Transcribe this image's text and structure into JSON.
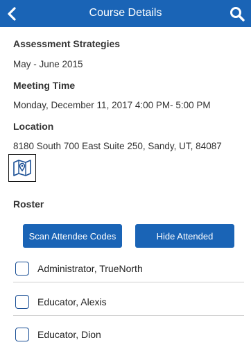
{
  "header": {
    "title": "Course Details",
    "back_icon": "chevron-left-icon",
    "search_icon": "search-icon",
    "color": "#1a64b6"
  },
  "course": {
    "name": "Assessment Strategies",
    "dates": "May - June 2015",
    "meeting_label": "Meeting Time",
    "meeting_value": "Monday, December 11, 2017  4:00 PM- 5:00 PM",
    "location_label": "Location",
    "location_value": "8180 South 700 East Suite 250, Sandy, UT, 84087",
    "map_icon": "map-pin-icon"
  },
  "roster": {
    "label": "Roster",
    "scan_button": "Scan Attendee Codes",
    "hide_button": "Hide Attended",
    "attendees": [
      {
        "name": "Administrator, TrueNorth",
        "checked": false
      },
      {
        "name": "Educator, Alexis",
        "checked": false
      },
      {
        "name": "Educator, Dion",
        "checked": false
      }
    ]
  }
}
